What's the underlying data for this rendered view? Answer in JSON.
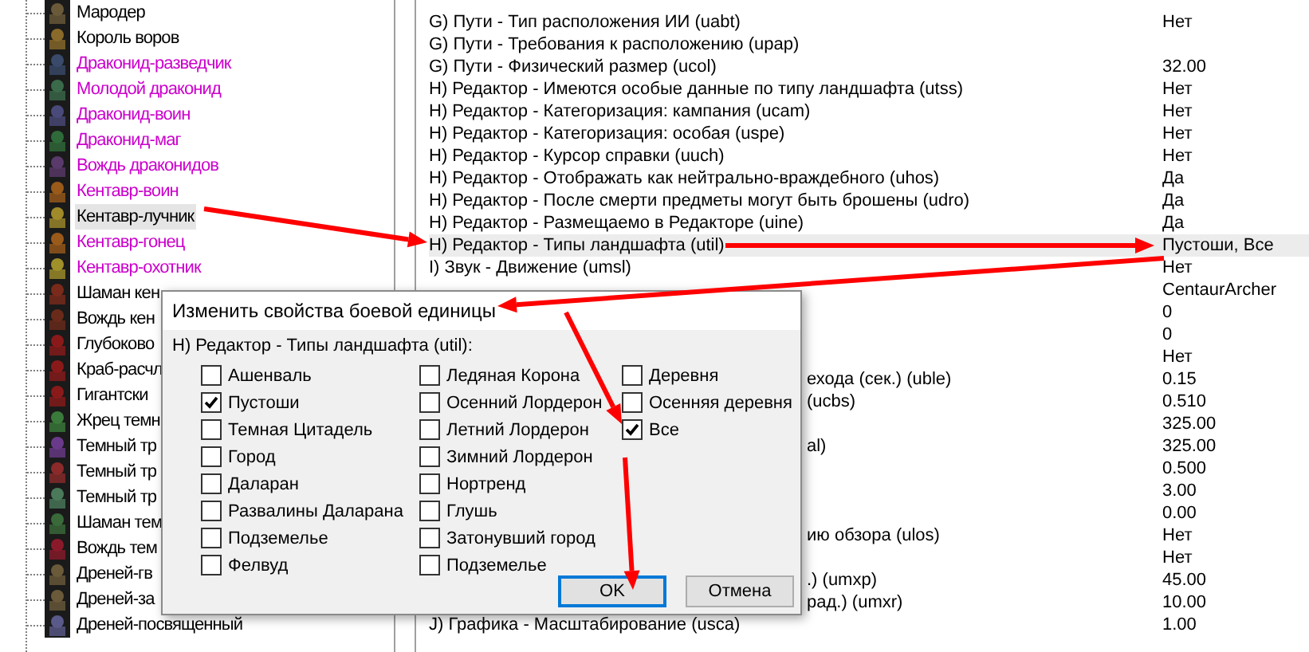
{
  "unit_tree": {
    "items": [
      {
        "text": "Мародер",
        "color": "#000000",
        "selected": false
      },
      {
        "text": "Король воров",
        "color": "#000000",
        "selected": false
      },
      {
        "text": "Драконид-разведчик",
        "color": "#cc00cc",
        "selected": false
      },
      {
        "text": "Молодой драконид",
        "color": "#cc00cc",
        "selected": false
      },
      {
        "text": "Драконид-воин",
        "color": "#cc00cc",
        "selected": false
      },
      {
        "text": "Драконид-маг",
        "color": "#cc00cc",
        "selected": false
      },
      {
        "text": "Вождь драконидов",
        "color": "#cc00cc",
        "selected": false
      },
      {
        "text": "Кентавр-воин",
        "color": "#cc00cc",
        "selected": false
      },
      {
        "text": "Кентавр-лучник",
        "color": "#000000",
        "selected": true
      },
      {
        "text": "Кентавр-гонец",
        "color": "#cc00cc",
        "selected": false
      },
      {
        "text": "Кентавр-охотник",
        "color": "#cc00cc",
        "selected": false
      },
      {
        "text": "Шаман кен",
        "color": "#000000",
        "selected": false
      },
      {
        "text": "Вождь кен",
        "color": "#000000",
        "selected": false
      },
      {
        "text": "Глубоково",
        "color": "#000000",
        "selected": false
      },
      {
        "text": "Краб-расчл",
        "color": "#000000",
        "selected": false
      },
      {
        "text": "Гигантски",
        "color": "#000000",
        "selected": false
      },
      {
        "text": "Жрец темн",
        "color": "#000000",
        "selected": false
      },
      {
        "text": "Темный тр",
        "color": "#000000",
        "selected": false
      },
      {
        "text": "Темный тр",
        "color": "#000000",
        "selected": false
      },
      {
        "text": "Темный тр",
        "color": "#000000",
        "selected": false
      },
      {
        "text": "Шаман тем",
        "color": "#000000",
        "selected": false
      },
      {
        "text": "Вождь тем",
        "color": "#000000",
        "selected": false
      },
      {
        "text": "Дреней-гв",
        "color": "#000000",
        "selected": false
      },
      {
        "text": "Дреней-за",
        "color": "#000000",
        "selected": false
      },
      {
        "text": "Дреней-посвященный",
        "color": "#000000",
        "selected": false
      }
    ]
  },
  "properties": {
    "rows": [
      {
        "name": "G) Пути - Тип расположения ИИ (uabt)",
        "value": "Нет",
        "selected": false
      },
      {
        "name": "G) Пути - Требования к расположению (upap)",
        "selected": false
      },
      {
        "name": "G) Пути - Физический размер (ucol)",
        "value": "32.00",
        "selected": false
      },
      {
        "name": "H) Редактор - Имеются особые данные по типу ландшафта (utss)",
        "value": "Нет",
        "selected": false
      },
      {
        "name": "H) Редактор - Категоризация: кампания (ucam)",
        "value": "Нет",
        "selected": false
      },
      {
        "name": "H) Редактор - Категоризация: особая (uspe)",
        "value": "Нет",
        "selected": false
      },
      {
        "name": "H) Редактор - Курсор справки (uuch)",
        "value": "Нет",
        "selected": false
      },
      {
        "name": "H) Редактор - Отображать как нейтрально-враждебного (uhos)",
        "value": "Да",
        "selected": false
      },
      {
        "name": "H) Редактор - После смерти предметы могут быть брошены (udro)",
        "value": "Да",
        "selected": false
      },
      {
        "name": "H) Редактор - Размещаемо в Редакторе (uine)",
        "value": "Да",
        "selected": false
      },
      {
        "name": "H) Редактор - Типы ландшафта (util)",
        "value": "Пустоши, Все",
        "selected": true
      },
      {
        "name": "I) Звук - Движение (umsl)",
        "value": "Нет",
        "selected": false
      },
      {
        "value": "CentaurArcher",
        "selected": false
      },
      {
        "value": "0",
        "selected": false
      },
      {
        "value": "0",
        "selected": false
      },
      {
        "value": "Нет",
        "selected": false
      },
      {
        "name_tail": "ехода (сек.) (uble)",
        "value": "0.15",
        "selected": false
      },
      {
        "name_tail": "(ucbs)",
        "value": "0.510",
        "selected": false
      },
      {
        "value": "325.00",
        "selected": false
      },
      {
        "name_tail": "al)",
        "value": "325.00",
        "selected": false
      },
      {
        "value": "0.500",
        "selected": false
      },
      {
        "value": "3.00",
        "selected": false
      },
      {
        "value": "0.00",
        "selected": false
      },
      {
        "name_tail": "ию обзора (ulos)",
        "value": "Нет",
        "selected": false
      },
      {
        "value": "Нет",
        "selected": false
      },
      {
        "name_tail": ".) (umxp)",
        "value": "45.00",
        "selected": false
      },
      {
        "name_tail": "рад.) (umxr)",
        "value": "10.00",
        "selected": false
      },
      {
        "name": "J) Графика - Масштабирование (usca)",
        "value": "1.00",
        "selected": false
      }
    ]
  },
  "dialog": {
    "title": "Изменить свойства боевой единицы",
    "field_label": "H) Редактор - Типы ландшафта (util):",
    "columns": [
      {
        "options": [
          {
            "label": "Ашенваль",
            "checked": false
          },
          {
            "label": "Пустоши",
            "checked": true
          },
          {
            "label": "Темная Цитадель",
            "checked": false
          },
          {
            "label": "Город",
            "checked": false
          },
          {
            "label": "Даларан",
            "checked": false
          },
          {
            "label": "Развалины Даларана",
            "checked": false
          },
          {
            "label": "Подземелье",
            "checked": false
          },
          {
            "label": "Фелвуд",
            "checked": false
          }
        ]
      },
      {
        "options": [
          {
            "label": "Ледяная Корона",
            "checked": false
          },
          {
            "label": "Осенний Лордерон",
            "checked": false
          },
          {
            "label": "Летний Лордерон",
            "checked": false
          },
          {
            "label": "Зимний Лордерон",
            "checked": false
          },
          {
            "label": "Нортренд",
            "checked": false
          },
          {
            "label": "Глушь",
            "checked": false
          },
          {
            "label": "Затонувший город",
            "checked": false
          },
          {
            "label": "Подземелье",
            "checked": false
          }
        ]
      },
      {
        "options": [
          {
            "label": "Деревня",
            "checked": false
          },
          {
            "label": "Осенняя деревня",
            "checked": false
          },
          {
            "label": "Все",
            "checked": true
          }
        ]
      }
    ],
    "buttons": [
      {
        "label": "OK",
        "kind": "default"
      },
      {
        "label": "Отмена",
        "kind": "normal"
      }
    ]
  }
}
